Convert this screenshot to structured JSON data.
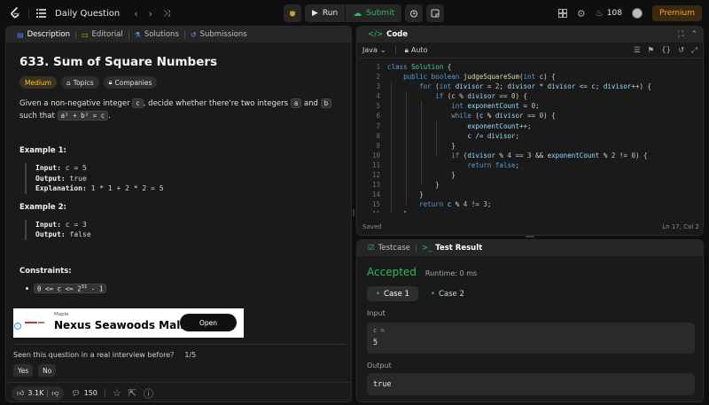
{
  "topbar": {
    "title": "Daily Question",
    "run_label": "Run",
    "submit_label": "Submit",
    "streak_count": "108",
    "premium_label": "Premium"
  },
  "left_tabs": [
    {
      "label": "Description"
    },
    {
      "label": "Editorial"
    },
    {
      "label": "Solutions"
    },
    {
      "label": "Submissions"
    }
  ],
  "problem": {
    "title": "633. Sum of Square Numbers",
    "difficulty": "Medium",
    "topics_label": "Topics",
    "companies_label": "Companies",
    "text_before": "Given a non-negative integer",
    "var_c": "c",
    "text_mid": ", decide whether there're two integers",
    "var_a": "a",
    "text_and": "and",
    "var_b": "b",
    "text_such": "such that",
    "equation": "a² + b² = c",
    "period": ".",
    "example1_title": "Example 1:",
    "example1": {
      "input_label": "Input:",
      "input_value": "c = 5",
      "output_label": "Output:",
      "output_value": "true",
      "explanation_label": "Explanation:",
      "explanation_value": "1 * 1 + 2 * 2 = 5"
    },
    "example2_title": "Example 2:",
    "example2": {
      "input_label": "Input:",
      "input_value": "c = 3",
      "output_label": "Output:",
      "output_value": "false"
    },
    "constraints_title": "Constraints:",
    "constraint_prefix": "0 <= c <= 2",
    "constraint_exp": "31",
    "constraint_suffix": " - 1"
  },
  "ad": {
    "brand": "Maple",
    "headline": "Nexus Seawoods Mall",
    "cta": "Open"
  },
  "interview": {
    "question": "Seen this question in a real interview before?",
    "count": "1/5",
    "yes": "Yes",
    "no": "No"
  },
  "footer": {
    "likes": "3.1K",
    "comments": "150"
  },
  "code_panel": {
    "title": "Code",
    "language": "Java",
    "auto_label": "Auto",
    "status": "Saved",
    "cursor": "Ln 17, Col 2",
    "line_numbers": [
      "1",
      "2",
      "3",
      "4",
      "5",
      "6",
      "7",
      "8",
      "9",
      "10",
      "11",
      "12",
      "13",
      "14",
      "15",
      "16",
      "17"
    ]
  },
  "result_panel": {
    "tab_testcase": "Testcase",
    "tab_result": "Test Result",
    "status": "Accepted",
    "runtime": "Runtime: 0 ms",
    "case1": "Case 1",
    "case2": "Case 2",
    "input_label": "Input",
    "input_var": "c =",
    "input_value": "5",
    "output_label": "Output",
    "output_value": "true"
  },
  "colors": {
    "accent_green": "#2cbb5d",
    "accent_orange": "#ffa116",
    "medium_yellow": "#ffc01e"
  }
}
